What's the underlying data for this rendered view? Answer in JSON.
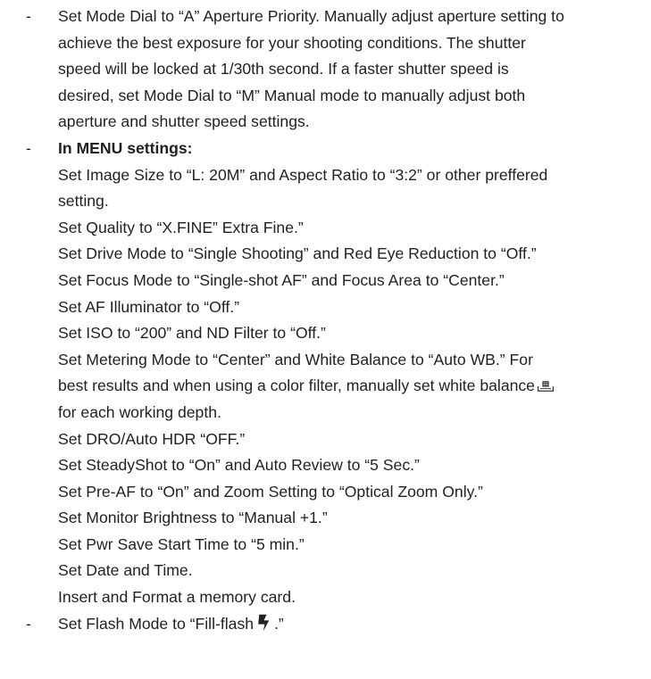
{
  "bullet_char": "-",
  "item1": {
    "lines": [
      "Set Mode Dial to “A” Aperture Priority. Manually adjust aperture setting to",
      "achieve the best exposure for your shooting conditions. The shutter",
      "speed will be locked at 1/30th second. If a faster shutter speed is",
      "desired, set Mode Dial to “M” Manual mode to manually adjust both",
      "aperture and shutter speed settings."
    ]
  },
  "item2": {
    "heading": "In MENU settings:",
    "lines": {
      "l1": "Set Image Size to “L: 20M” and Aspect Ratio to “3:2” or other preffered",
      "l2": "setting.",
      "l3": "Set Quality to “X.FINE” Extra Fine.”",
      "l4": "Set Drive Mode to “Single Shooting” and Red Eye Reduction to “Off.”",
      "l5": "Set Focus Mode to “Single-shot AF” and Focus Area to “Center.”",
      "l6": "Set AF Illuminator to “Off.”",
      "l7": "Set ISO to “200” and ND Filter to “Off.”",
      "l8": "Set Metering Mode to “Center” and White Balance to “Auto WB.” For",
      "l9": "best results and when using a color filter, manually set white balance",
      "l10": "for each working depth.",
      "l11": "Set DRO/Auto HDR “OFF.”",
      "l12": "Set SteadyShot to “On” and Auto Review to “5 Sec.”",
      "l13": "Set Pre-AF to “On” and Zoom Setting to “Optical Zoom Only.”",
      "l14": "Set Monitor Brightness to “Manual +1.”",
      "l15": "Set Pwr Save Start Time to “5 min.”",
      "l16": "Set Date and Time.",
      "l17": "Insert and Format a memory card."
    },
    "wb_icon": "white-balance-custom-icon"
  },
  "item3": {
    "text_before": "Set Flash Mode to “Fill-flash",
    "text_after": ".”",
    "icon": "flash-icon"
  },
  "colors": {
    "text": "#231f20",
    "background": "#ffffff"
  }
}
